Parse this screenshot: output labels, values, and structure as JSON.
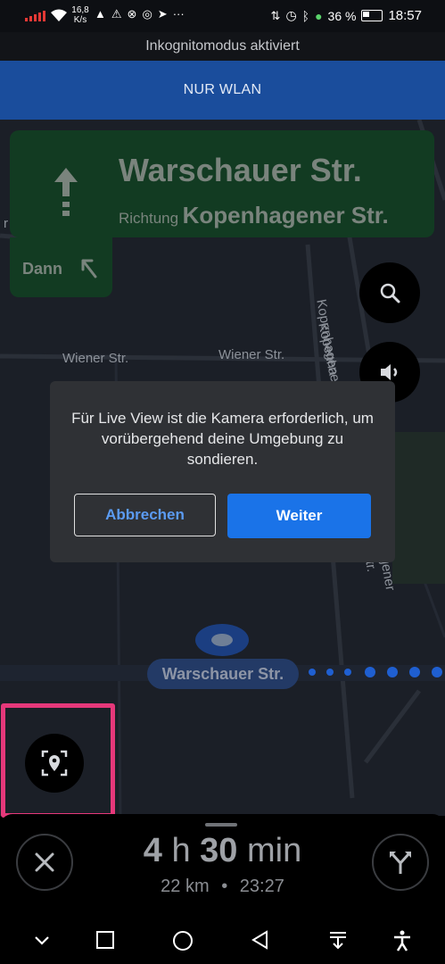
{
  "status_bar": {
    "net_speed_value": "16,8",
    "net_speed_unit": "K/s",
    "battery": "36 %",
    "time": "18:57",
    "overflow": "···"
  },
  "incognito_banner": "Inkognitomodus aktiviert",
  "network_banner": "NUR WLAN",
  "navigation": {
    "street": "Warschauer Str.",
    "direction_prefix": "Richtung",
    "direction_street": "Kopenhagener Str.",
    "then_label": "Dann"
  },
  "map": {
    "labels": {
      "wiener_left": "Wiener Str.",
      "wiener_right": "Wiener Str.",
      "kopenhagener_upper": "Kopenhagener Str.",
      "kopenhagener_mid": "Kopenha",
      "kopenhagener_lower": "agener Str.",
      "edge_fragment": "r"
    },
    "current_street": "Warschauer Str."
  },
  "dialog": {
    "message": "Für Live View ist die Kamera erforderlich, um vorübergehend deine Umgebung zu sondieren.",
    "cancel": "Abbrechen",
    "continue": "Weiter"
  },
  "trip": {
    "hours": "4",
    "hours_unit": "h",
    "minutes": "30",
    "minutes_unit": "min",
    "distance": "22 km",
    "separator": "•",
    "arrival": "23:27"
  },
  "colors": {
    "nav_green": "#123b22",
    "primary_blue": "#1a73e8",
    "highlight_pink": "#e6387a",
    "wlan_banner": "#1a4d9c"
  }
}
